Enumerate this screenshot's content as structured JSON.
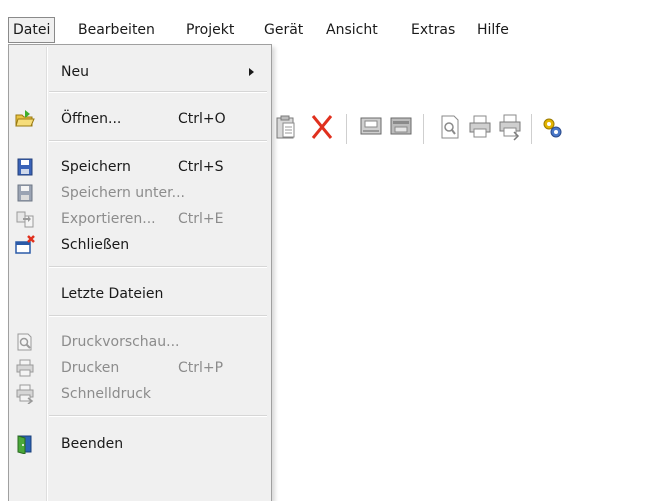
{
  "menubar": {
    "items": [
      "Datei",
      "Bearbeiten",
      "Projekt",
      "Gerät",
      "Ansicht",
      "Extras",
      "Hilfe"
    ]
  },
  "toolbar": {
    "icons": [
      "paste-icon",
      "delete-icon",
      "device-icon",
      "device-read-icon",
      "print-preview-icon",
      "print-icon",
      "quick-print-icon",
      "settings-icon"
    ]
  },
  "menu": {
    "new": {
      "label": "Neu"
    },
    "open": {
      "label": "Öffnen...",
      "shortcut": "Ctrl+O"
    },
    "save": {
      "label": "Speichern",
      "shortcut": "Ctrl+S"
    },
    "save_as": {
      "label": "Speichern unter..."
    },
    "export": {
      "label": "Exportieren...",
      "shortcut": "Ctrl+E"
    },
    "close": {
      "label": "Schließen"
    },
    "recent": {
      "label": "Letzte Dateien"
    },
    "preview": {
      "label": "Druckvorschau..."
    },
    "print": {
      "label": "Drucken",
      "shortcut": "Ctrl+P"
    },
    "quick_print": {
      "label": "Schnelldruck"
    },
    "exit": {
      "label": "Beenden"
    }
  },
  "colors": {
    "menu_bg": "#f0f0f0",
    "disabled_text": "#8c8c8c",
    "delete_red": "#e0301e",
    "save_blue": "#3a63b8"
  }
}
